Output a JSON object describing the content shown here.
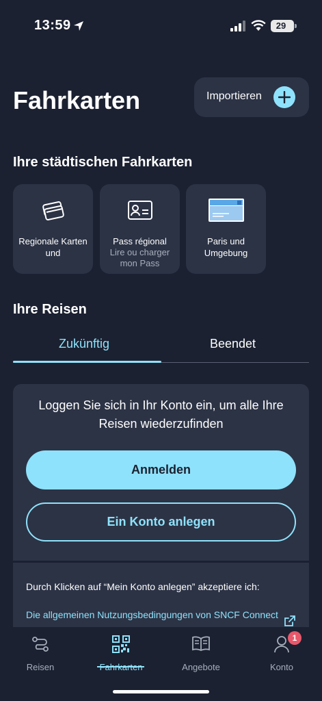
{
  "status": {
    "time": "13:59",
    "battery": "29"
  },
  "header": {
    "title": "Fahrkarten",
    "import_label": "Importieren"
  },
  "city_tickets": {
    "title": "Ihre städtischen Fahrkarten",
    "cards": [
      {
        "label": "Regionale Karten und",
        "sub": ""
      },
      {
        "label": "Pass régional",
        "sub": "Lire ou charger mon Pass"
      },
      {
        "label": "Paris und Umgebung",
        "sub": ""
      }
    ]
  },
  "trips": {
    "title": "Ihre Reisen",
    "tabs": [
      {
        "label": "Zukünftig"
      },
      {
        "label": "Beendet"
      }
    ],
    "active_tab": 0
  },
  "login": {
    "message": "Loggen Sie sich in Ihr Konto ein, um alle Ihre Reisen wiederzufinden",
    "login_button": "Anmelden",
    "register_button": "Ein Konto anlegen"
  },
  "terms": {
    "text": "Durch Klicken auf “Mein Konto anlegen” akzeptiere ich:",
    "link": "Die allgemeinen Nutzungsbedingungen von SNCF Connect"
  },
  "bottom_nav": {
    "items": [
      {
        "label": "Reisen",
        "icon": "route-icon"
      },
      {
        "label": "Fahrkarten",
        "icon": "qr-code-icon"
      },
      {
        "label": "Angebote",
        "icon": "book-icon"
      },
      {
        "label": "Konto",
        "icon": "person-icon"
      }
    ],
    "active": 1,
    "account_badge": "1"
  },
  "colors": {
    "background": "#1b2131",
    "card": "#2c3345",
    "accent": "#8fe2fb",
    "badge": "#e8586b"
  }
}
